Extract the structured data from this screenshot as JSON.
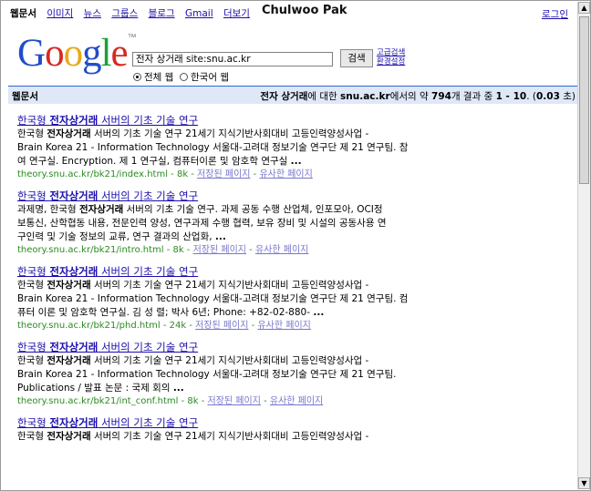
{
  "nav": {
    "items": [
      {
        "label": "웹문서",
        "current": true
      },
      {
        "label": "이미지"
      },
      {
        "label": "뉴스"
      },
      {
        "label": "그룹스"
      },
      {
        "label": "블로그"
      },
      {
        "label": "Gmail"
      },
      {
        "label": "더보기"
      }
    ],
    "login": "로그인"
  },
  "overlay_title": "Chulwoo Pak",
  "logo": {
    "letters": [
      "G",
      "o",
      "o",
      "g",
      "l",
      "e"
    ],
    "tm": "™"
  },
  "search": {
    "value": "전자 상거래 site:snu.ac.kr",
    "button": "검색",
    "advanced": "고급검색",
    "prefs": "환경설정"
  },
  "scope": {
    "all": "전체 웹",
    "korean": "한국어 웹"
  },
  "stats": {
    "tab": "웹문서",
    "query": "전자 상거래",
    "mid1": "에 대한 ",
    "site": "snu.ac.kr",
    "mid2": "에서의 약 ",
    "total": "794",
    "mid3": "개 결과 중 ",
    "range": "1 - 10",
    "mid4": ". (",
    "time": "0.03",
    "mid5": " 초)"
  },
  "results": [
    {
      "title_pre": "한국형 ",
      "title_bold": "전자상거래",
      "title_post": " 서버의 기초 기술 연구",
      "lines": [
        {
          "pre": "한국형 ",
          "bold": "전자상거래",
          "post": " 서버의 기초 기술 연구 21세기 지식기반사회대비 고등인력양성사업 -"
        },
        {
          "pre": "Brain Korea 21 - Information Technology 서울대-고려대 정보기술 연구단 제 21 연구팀. 참",
          "bold": "",
          "post": ""
        },
        {
          "pre": "여 연구실. Encryption. 제 1 연구실, 컴퓨터이론 및 암호학 연구실 ",
          "bold": "...",
          "post": ""
        }
      ],
      "url": "theory.snu.ac.kr/bk21/index.html - 8k - ",
      "cached": "저장된 페이지",
      "similar": "유사한 페이지"
    },
    {
      "title_pre": "한국형 ",
      "title_bold": "전자상거래",
      "title_post": " 서버의 기초 기술 연구",
      "lines": [
        {
          "pre": "과제명, 한국형 ",
          "bold": "전자상거래",
          "post": " 서버의 기초 기술 연구. 과제 공동 수행 산업체, 인포모아, OCI정"
        },
        {
          "pre": "보통신, 산학협동 내용, 전문인력 양성, 연구과제 수행 협력, 보유 장비 및 시설의 공동사용 연",
          "bold": "",
          "post": ""
        },
        {
          "pre": "구인력 및 기술 정보의 교류, 연구 결과의 산업화, ",
          "bold": "...",
          "post": ""
        }
      ],
      "url": "theory.snu.ac.kr/bk21/intro.html - 8k - ",
      "cached": "저장된 페이지",
      "similar": "유사한 페이지"
    },
    {
      "title_pre": "한국형 ",
      "title_bold": "전자상거래",
      "title_post": " 서버의 기초 기술 연구",
      "lines": [
        {
          "pre": "한국형 ",
          "bold": "전자상거래",
          "post": " 서버의 기초 기술 연구 21세기 지식기반사회대비 고등인력양성사업 -"
        },
        {
          "pre": "Brain Korea 21 - Information Technology 서울대-고려대 정보기술 연구단 제 21 연구팀. 컴",
          "bold": "",
          "post": ""
        },
        {
          "pre": "퓨터 이론 및 암호학 연구실. 김 성 렬; 박사 6년; Phone: +82-02-880- ",
          "bold": "...",
          "post": ""
        }
      ],
      "url": "theory.snu.ac.kr/bk21/phd.html - 24k - ",
      "cached": "저장된 페이지",
      "similar": "유사한 페이지"
    },
    {
      "title_pre": "한국형 ",
      "title_bold": "전자상거래",
      "title_post": " 서버의 기초 기술 연구",
      "lines": [
        {
          "pre": "한국형 ",
          "bold": "전자상거래",
          "post": " 서버의 기초 기술 연구 21세기 지식기반사회대비 고등인력양성사업 -"
        },
        {
          "pre": "Brain Korea 21 - Information Technology 서울대-고려대 정보기술 연구단 제 21 연구팀.",
          "bold": "",
          "post": ""
        },
        {
          "pre": "Publications / 발표 논문 : 국제 회의 ",
          "bold": "...",
          "post": ""
        }
      ],
      "url": "theory.snu.ac.kr/bk21/int_conf.html - 8k - ",
      "cached": "저장된 페이지",
      "similar": "유사한 페이지"
    },
    {
      "title_pre": "한국형 ",
      "title_bold": "전자상거래",
      "title_post": " 서버의 기초 기술 연구",
      "lines": [
        {
          "pre": "한국형 ",
          "bold": "전자상거래",
          "post": " 서버의 기초 기술 연구 21세기 지식기반사회대비 고등인력양성사업 -"
        }
      ],
      "url": "",
      "cached": "",
      "similar": ""
    }
  ]
}
